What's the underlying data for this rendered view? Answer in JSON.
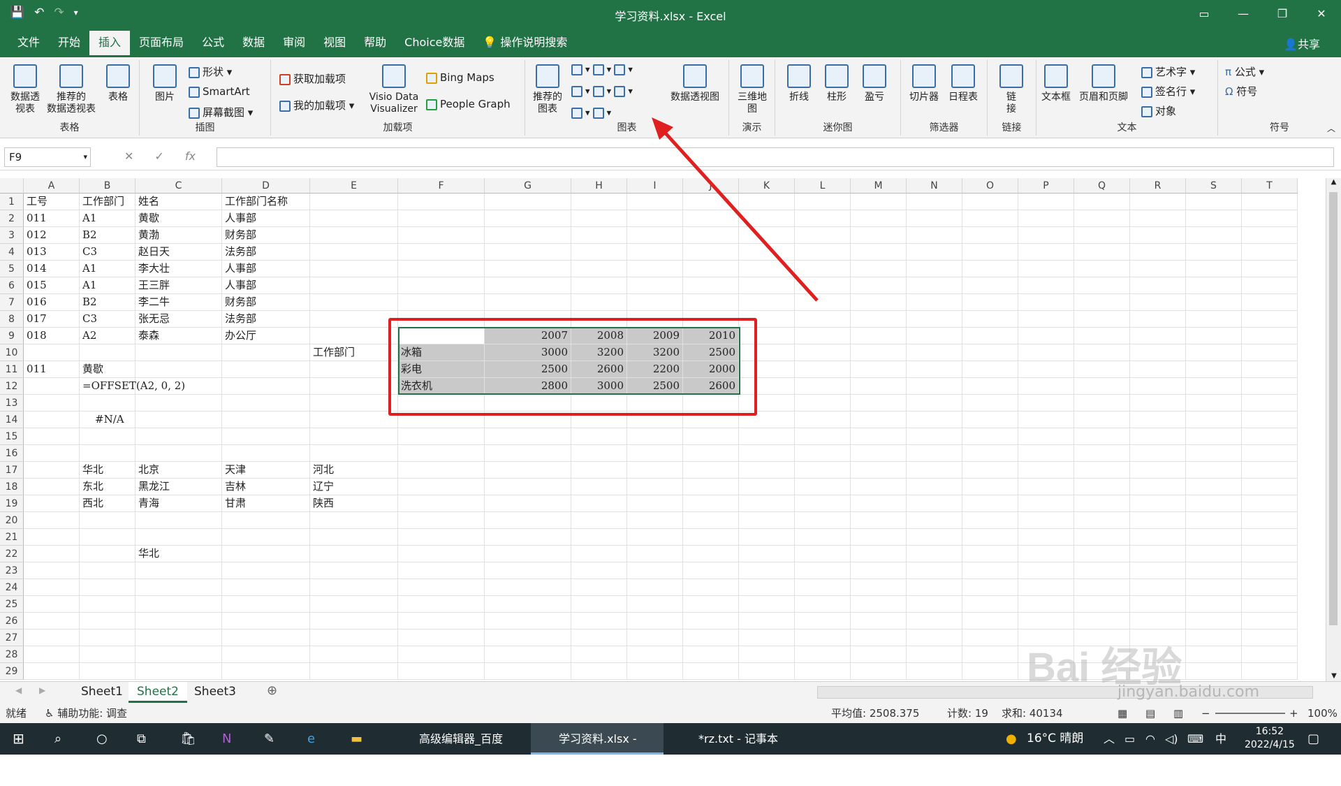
{
  "window": {
    "title": "学习资料.xlsx  -  Excel"
  },
  "tabs": [
    "文件",
    "开始",
    "插入",
    "页面布局",
    "公式",
    "数据",
    "审阅",
    "视图",
    "帮助",
    "Choice数据"
  ],
  "active_tab": "插入",
  "tell_me": "操作说明搜索",
  "share": "共享",
  "ribbon": {
    "tables": {
      "label": "表格",
      "pivot": "数据透\n视表",
      "recommended_pivot": "推荐的\n数据透视表",
      "table": "表格"
    },
    "illustrations": {
      "label": "插图",
      "pictures": "图片",
      "shapes": "形状",
      "smartart": "SmartArt",
      "screenshot": "屏幕截图"
    },
    "addins": {
      "label": "加载项",
      "get": "获取加载项",
      "my": "我的加载项",
      "visio": "Visio Data\nVisualizer",
      "bing": "Bing Maps",
      "people": "People Graph"
    },
    "charts": {
      "label": "图表",
      "recommended": "推荐的\n图表",
      "pivotchart": "数据透视图"
    },
    "tours": {
      "label": "演示",
      "map3d": "三维地\n图"
    },
    "sparklines": {
      "label": "迷你图",
      "line": "折线",
      "column": "柱形",
      "winloss": "盈亏"
    },
    "filters": {
      "label": "筛选器",
      "slicer": "切片器",
      "timeline": "日程表"
    },
    "links": {
      "label": "链接",
      "link": "链\n接"
    },
    "text": {
      "label": "文本",
      "textbox": "文本框",
      "headerfooter": "页眉和页脚",
      "wordart": "艺术字",
      "signature": "签名行",
      "object": "对象"
    },
    "symbols": {
      "label": "符号",
      "equation": "公式",
      "symbol": "符号"
    }
  },
  "formula_bar": {
    "namebox": "F9",
    "fx": "fx",
    "value": ""
  },
  "columns": [
    "A",
    "B",
    "C",
    "D",
    "E",
    "F",
    "G",
    "H",
    "I",
    "J",
    "K",
    "L",
    "M",
    "N",
    "O",
    "P",
    "Q",
    "R",
    "S",
    "T"
  ],
  "rows": [
    "1",
    "2",
    "3",
    "4",
    "5",
    "6",
    "7",
    "8",
    "9",
    "10",
    "11",
    "12",
    "13",
    "14",
    "15",
    "16",
    "17",
    "18",
    "19",
    "20",
    "21",
    "22",
    "23",
    "24",
    "25",
    "26",
    "27",
    "28",
    "29"
  ],
  "cells": {
    "A1": "工号",
    "B1": "工作部门",
    "C1": "姓名",
    "D1": "工作部门名称",
    "A2": "011",
    "B2": "A1",
    "C2": "黄歇",
    "D2": "人事部",
    "A3": "012",
    "B3": "B2",
    "C3": "黄渤",
    "D3": "财务部",
    "A4": "013",
    "B4": "C3",
    "C4": "赵日天",
    "D4": "法务部",
    "A5": "014",
    "B5": "A1",
    "C5": "李大壮",
    "D5": "人事部",
    "A6": "015",
    "B6": "A1",
    "C6": "王三胖",
    "D6": "人事部",
    "A7": "016",
    "B7": "B2",
    "C7": "李二牛",
    "D7": "财务部",
    "A8": "017",
    "B8": "C3",
    "C8": "张无忌",
    "D8": "法务部",
    "A9": "018",
    "B9": "A2",
    "C9": "泰森",
    "D9": "办公厅",
    "E10": "工作部门",
    "A11": "011",
    "B11": "黄歇",
    "B12": "=OFFSET(A2, 0, 2)",
    "B14": "#N/A",
    "B17": "华北",
    "C17": "北京",
    "D17": "天津",
    "E17": "河北",
    "B18": "东北",
    "C18": "黑龙江",
    "D18": "吉林",
    "E18": "辽宁",
    "B19": "西北",
    "C19": "青海",
    "D19": "甘肃",
    "E19": "陕西",
    "C22": "华北",
    "G9": "2007",
    "H9": "2008",
    "I9": "2009",
    "J9": "2010",
    "F10": "冰箱",
    "G10": "3000",
    "H10": "3200",
    "I10": "3200",
    "J10": "2500",
    "F11": "彩电",
    "G11": "2500",
    "H11": "2600",
    "I11": "2200",
    "J11": "2000",
    "F12": "洗衣机",
    "G12": "2800",
    "H12": "3000",
    "I12": "2500",
    "J12": "2600"
  },
  "sheets": [
    "Sheet1",
    "Sheet2",
    "Sheet3"
  ],
  "active_sheet": "Sheet2",
  "status": {
    "ready": "就绪",
    "accessibility": "辅助功能: 调查",
    "average": "平均值: 2508.375",
    "count": "计数: 19",
    "sum": "求和: 40134",
    "zoom": "100%"
  },
  "taskbar": {
    "apps": [
      "高级编辑器_百度经...",
      "学习资料.xlsx - Ex...",
      "*rz.txt - 记事本"
    ],
    "weather": "16°C  晴朗",
    "ime": "中",
    "time": "16:52",
    "date": "2022/4/15"
  },
  "watermark": {
    "text": "Bai 经验",
    "url": "jingyan.baidu.com"
  },
  "colors": {
    "excel_green": "#217346",
    "highlight_red": "#e02020",
    "selection_gray": "#c9c9c9"
  }
}
